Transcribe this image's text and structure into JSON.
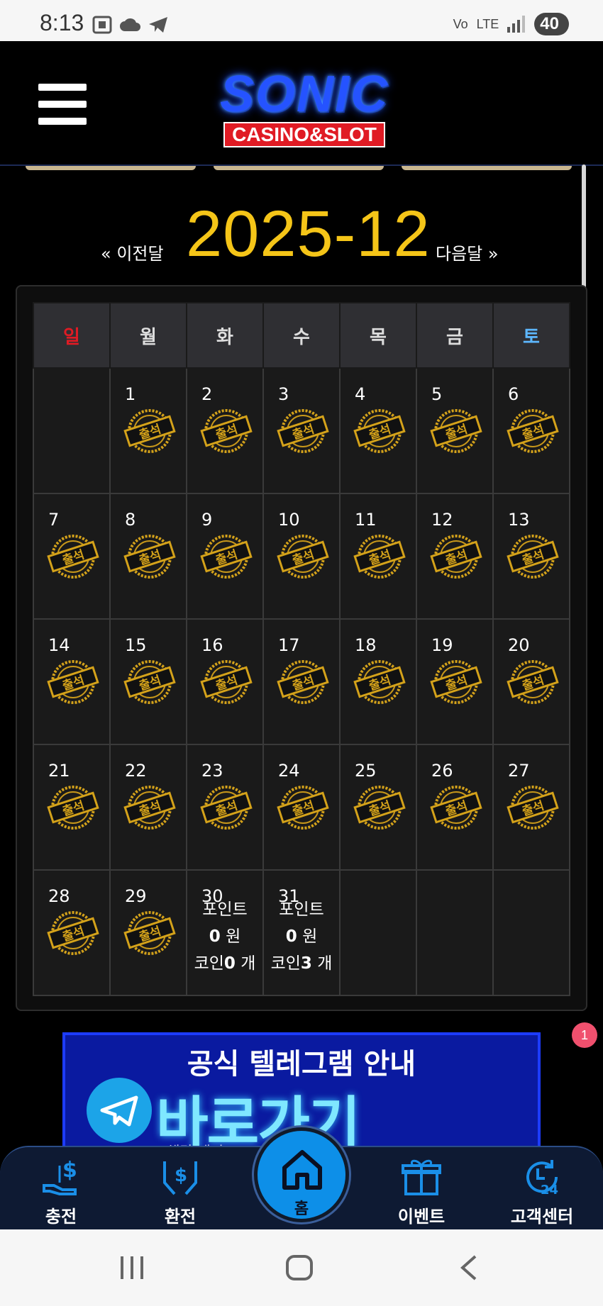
{
  "status_bar": {
    "time": "8:13",
    "network": "LTE",
    "battery": "40"
  },
  "header": {
    "logo_main": "SONIC",
    "logo_sub": "CASINO&SLOT"
  },
  "calendar": {
    "prev_label": "« 이전달",
    "next_label": "다음달 »",
    "title": "2025-12",
    "weekdays": [
      "일",
      "월",
      "화",
      "수",
      "목",
      "금",
      "토"
    ],
    "stamp_label": "출석",
    "weeks": [
      [
        "",
        "1",
        "2",
        "3",
        "4",
        "5",
        "6"
      ],
      [
        "7",
        "8",
        "9",
        "10",
        "11",
        "12",
        "13"
      ],
      [
        "14",
        "15",
        "16",
        "17",
        "18",
        "19",
        "20"
      ],
      [
        "21",
        "22",
        "23",
        "24",
        "25",
        "26",
        "27"
      ],
      [
        "28",
        "29",
        "30",
        "31",
        "",
        "",
        ""
      ]
    ],
    "attended_until": 29,
    "info_cells": {
      "30": {
        "line1": "포인트",
        "points": "0",
        "unit": "원",
        "coin_prefix": "코인",
        "coins": "0",
        "coin_unit": "개"
      },
      "31": {
        "line1": "포인트",
        "points": "0",
        "unit": "원",
        "coin_prefix": "코인",
        "coins": "3",
        "coin_unit": "개"
      }
    }
  },
  "notification": {
    "count": "1"
  },
  "banner": {
    "title": "공식 텔레그램 안내",
    "cta": "바로가기 CLICK",
    "note": "※ 해당 게시..."
  },
  "bottom_nav": {
    "items": [
      {
        "label": "충전",
        "icon": "charge-icon"
      },
      {
        "label": "환전",
        "icon": "exchange-icon"
      },
      {
        "label": "홈",
        "icon": "home-icon"
      },
      {
        "label": "이벤트",
        "icon": "gift-icon"
      },
      {
        "label": "고객센터",
        "icon": "support-24-icon"
      }
    ]
  },
  "colors": {
    "accent_yellow": "#f5c518",
    "sunday_red": "#e01b24",
    "saturday_blue": "#5db7ff",
    "nav_blue": "#0d8fe8"
  }
}
